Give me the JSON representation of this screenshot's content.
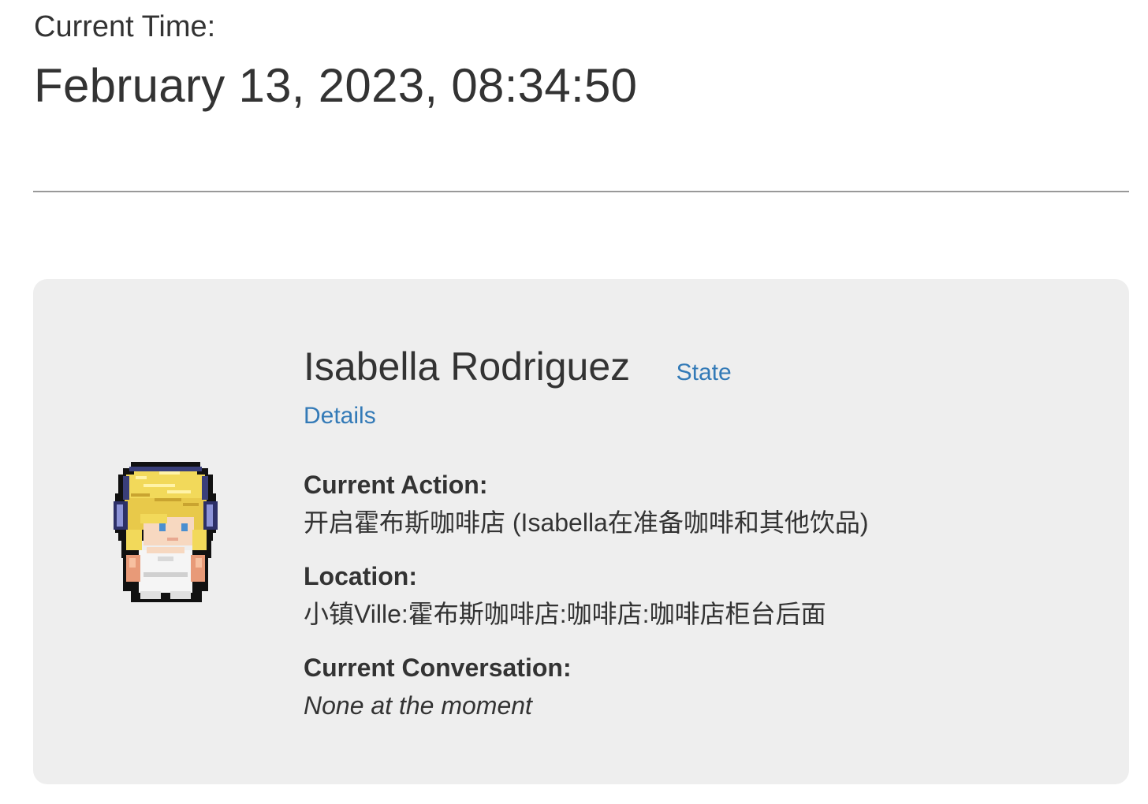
{
  "header": {
    "time_label": "Current Time:",
    "time_value": "February 13, 2023, 08:34:50"
  },
  "persona": {
    "name": "Isabella Rodriguez",
    "state_link": "State",
    "details_link": "Details",
    "avatar_icon": "pixel-character-avatar-icon",
    "current_action": {
      "label": "Current Action:",
      "value": "开启霍布斯咖啡店 (Isabella在准备咖啡和其他饮品)"
    },
    "location": {
      "label": "Location:",
      "value": "小镇Ville:霍布斯咖啡店:咖啡店:咖啡店柜台后面"
    },
    "conversation": {
      "label": "Current Conversation:",
      "value": "None at the moment"
    }
  },
  "colors": {
    "link": "#337ab7",
    "card_background": "#eeeeee",
    "text": "#333333",
    "divider": "#999999"
  }
}
